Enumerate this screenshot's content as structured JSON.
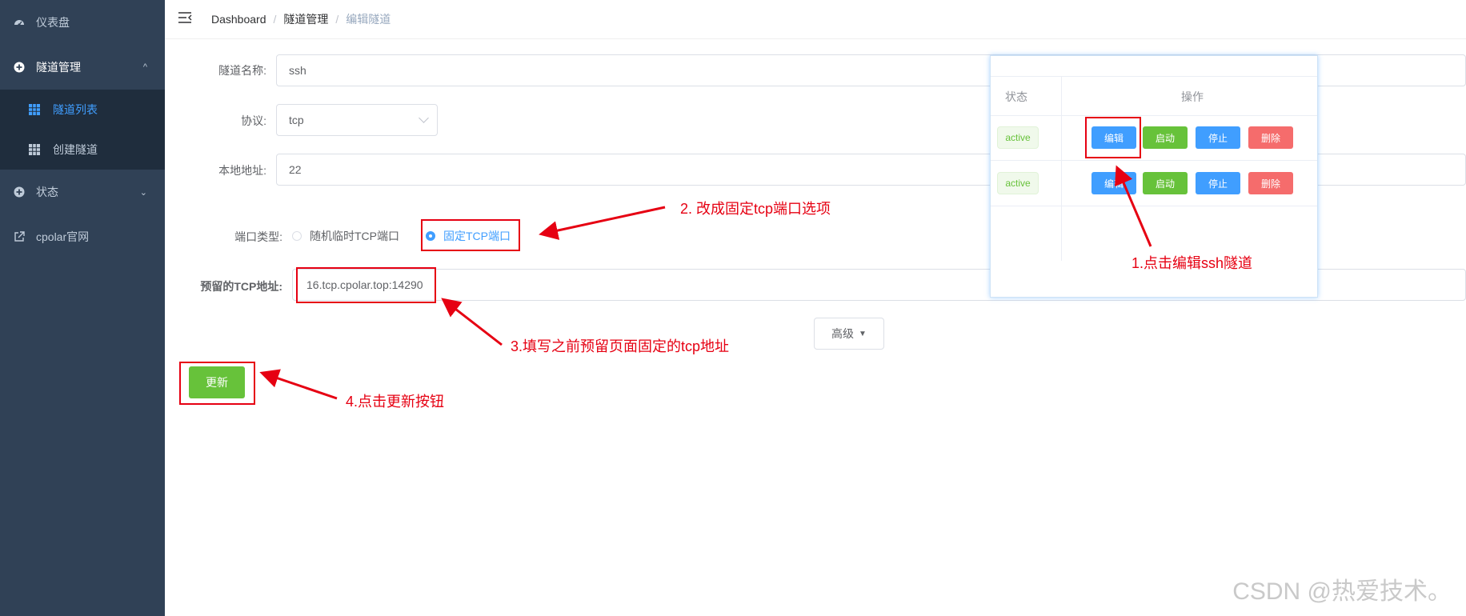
{
  "sidebar": {
    "items": [
      {
        "label": "仪表盘",
        "icon": "dashboard-icon"
      },
      {
        "label": "隧道管理",
        "icon": "plus-circle-icon"
      },
      {
        "label": "隧道列表",
        "icon": "grid-icon"
      },
      {
        "label": "创建隧道",
        "icon": "grid-icon"
      },
      {
        "label": "状态",
        "icon": "plus-circle-icon"
      },
      {
        "label": "cpolar官网",
        "icon": "external-link-icon"
      }
    ]
  },
  "breadcrumb": {
    "items": [
      "Dashboard",
      "隧道管理",
      "编辑隧道"
    ],
    "separator": "/"
  },
  "form": {
    "name_label": "隧道名称:",
    "name_value": "ssh",
    "protocol_label": "协议:",
    "protocol_value": "tcp",
    "local_label": "本地地址:",
    "local_value": "22",
    "port_type_label": "端口类型:",
    "port_type_options": [
      "随机临时TCP端口",
      "固定TCP端口"
    ],
    "port_type_selected": "固定TCP端口",
    "reserved_label": "预留的TCP地址:",
    "reserved_value": "16.tcp.cpolar.top:14290",
    "advanced_label": "高级",
    "update_label": "更新"
  },
  "panel": {
    "headers": [
      "状态",
      "操作"
    ],
    "rows": [
      {
        "status": "active",
        "actions": [
          "编辑",
          "启动",
          "停止",
          "删除"
        ]
      },
      {
        "status": "active",
        "actions": [
          "编辑",
          "启动",
          "停止",
          "删除"
        ]
      }
    ]
  },
  "annotations": {
    "a1": "1.点击编辑ssh隧道",
    "a2": "2. 改成固定tcp端口选项",
    "a3": "3.填写之前预留页面固定的tcp地址",
    "a4": "4.点击更新按钮"
  },
  "watermark": "CSDN @热爱技术。",
  "colors": {
    "sidebar_bg": "#304156",
    "primary": "#409eff",
    "success": "#67c23a",
    "danger": "#f56c6c",
    "annotation": "#e60012"
  }
}
